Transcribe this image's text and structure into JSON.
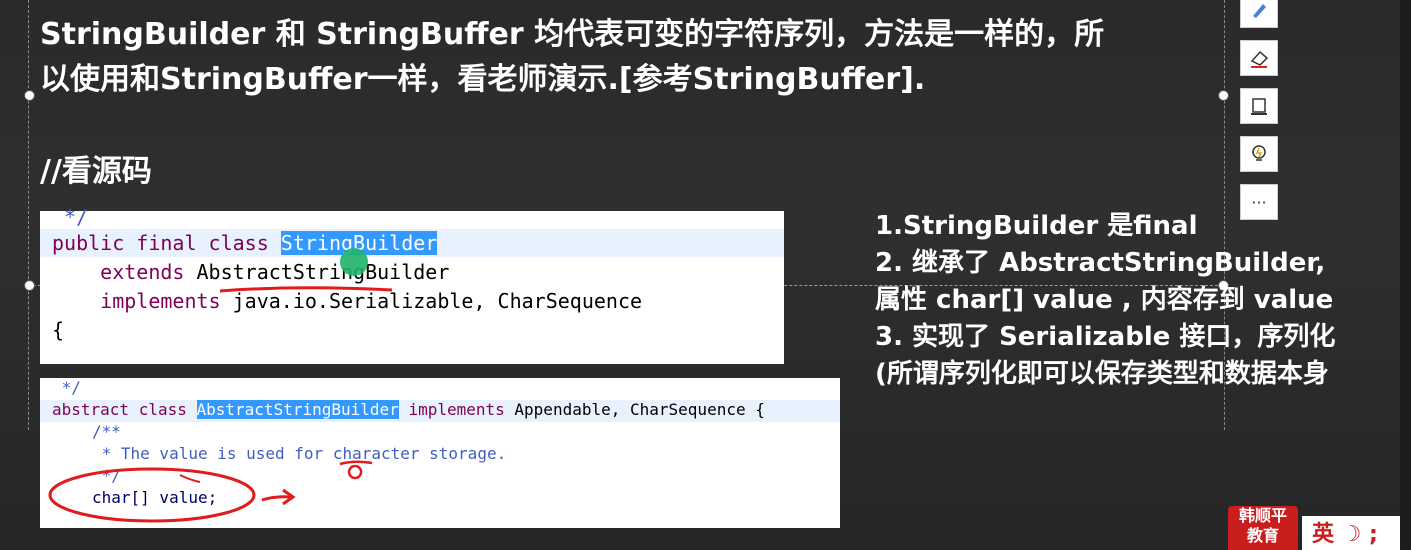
{
  "slide": {
    "title": "StringBuilder 和 StringBuffer 均代表可变的字符序列，方法是一样的，所\n以使用和StringBuffer一样，看老师演示.[参考StringBuffer].",
    "comment": "//看源码"
  },
  "code1": {
    "lines": [
      " */",
      "public final class ",
      "StringBuilder",
      "    extends AbstractStringBuilder",
      "    implements java.io.Serializable, CharSequence",
      "{"
    ],
    "kw_public_final_class": "public final class",
    "kw_extends": "extends",
    "kw_implements": "implements",
    "extends_target": "AbstractStringBuilder",
    "implements_targets": "java.io.Serializable, CharSequence"
  },
  "code2": {
    "l0": " */",
    "kw_abstract_class": "abstract class",
    "class_name": "AbstractStringBuilder",
    "kw_implements": "implements",
    "implements_targets": "Appendable, CharSequence {",
    "doc_open": "/**",
    "doc_body": " * The value is used for character storage.",
    "doc_close": " */",
    "field": "char[] value;"
  },
  "notes": [
    "1.StringBuilder 是final",
    "2. 继承了 AbstractStringBuilder,",
    "属性 char[] value , 内容存到 value",
    "3. 实现了 Serializable 接口，序列化",
    "(所谓序列化即可以保存类型和数据本身"
  ],
  "toolbar": {
    "icons": [
      "pen-icon",
      "eraser-icon",
      "frame-icon",
      "bulb-icon",
      "more-icon"
    ],
    "more_label": "···"
  },
  "brand": {
    "logo_text": "韩顺平\n教育",
    "ime_text": "英 ☽ ;"
  },
  "colors": {
    "keyword": "#7f0055",
    "javadoc": "#3f5fbf",
    "highlight": "#3399ff",
    "annotation": "#e21b1b"
  }
}
